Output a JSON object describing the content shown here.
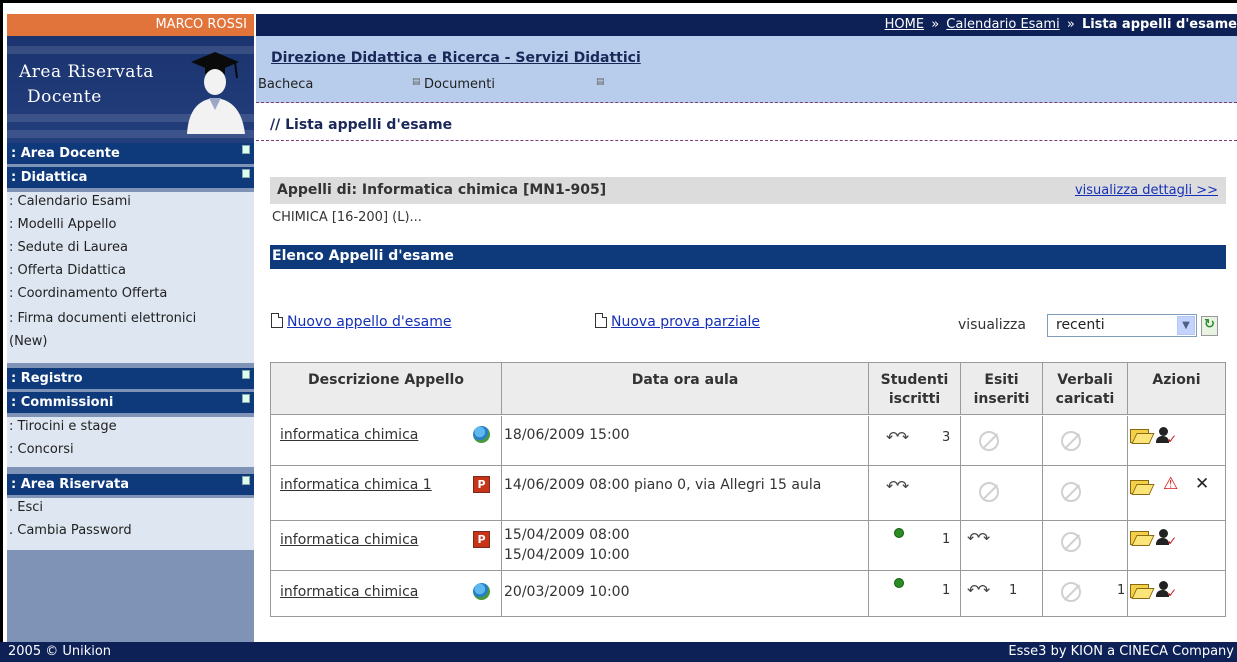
{
  "user": {
    "name": "MARCO ROSSI"
  },
  "breadcrumb": {
    "home": "HOME",
    "sep1": "»",
    "calendario": "Calendario Esami",
    "sep2": "»",
    "current": "Lista appelli d'esame"
  },
  "sidebar": {
    "logo_line1": "Area Riservata",
    "logo_line2": "Docente",
    "sections": {
      "area_docente": ": Area Docente",
      "didattica": ": Didattica",
      "registro": ": Registro",
      "commissioni": ": Commissioni",
      "area_riservata": ": Area Riservata"
    },
    "didattica_items": [
      ": Calendario Esami",
      ": Modelli Appello",
      ": Sedute di Laurea",
      ": Offerta Didattica",
      ": Coordinamento Offerta",
      ": Firma documenti elettronici (New)"
    ],
    "commissioni_items": [
      ": Tirocini e stage",
      ": Concorsi"
    ],
    "riservata_items": [
      ". Esci",
      ". Cambia Password"
    ]
  },
  "header": {
    "dept": "Direzione Didattica e Ricerca - Servizi Didattici",
    "tabs": [
      "Bacheca",
      "Documenti"
    ],
    "page_title": "// Lista appelli d'esame"
  },
  "appelli": {
    "label": "Appelli di: Informatica chimica [MN1-905]",
    "details_link": "visualizza dettagli >>",
    "course": "CHIMICA [16-200] (L)..."
  },
  "elenco": {
    "title": "Elenco Appelli d'esame"
  },
  "actions": {
    "nuovo_appello": "Nuovo appello d'esame",
    "nuova_prova": "Nuova prova parziale",
    "visualizza_label": "visualizza",
    "visualizza_value": "recenti"
  },
  "table": {
    "headers": {
      "descrizione": "Descrizione Appello",
      "data": "Data ora aula",
      "studenti": "Studenti iscritti",
      "esiti": "Esiti inseriti",
      "verbali": "Verbali caricati",
      "azioni": "Azioni"
    },
    "rows": [
      {
        "desc": "informatica chimica",
        "date": "18/06/2009 15:00",
        "iscritti": "3",
        "esiti": "",
        "verbali": ""
      },
      {
        "desc": "informatica chimica 1",
        "date": "14/06/2009 08:00 piano 0, via Allegri 15 aula",
        "iscritti": "",
        "esiti": "",
        "verbali": ""
      },
      {
        "desc": "informatica chimica",
        "date": "15/04/2009 08:00\n15/04/2009 10:00",
        "iscritti": "1",
        "esiti": "",
        "verbali": ""
      },
      {
        "desc": "informatica chimica",
        "date": "20/03/2009 10:00",
        "iscritti": "1",
        "esiti": "1",
        "verbali": "1"
      }
    ]
  },
  "footer": {
    "left": "2005 © Unikion",
    "right": "Esse3 by KION a CINECA Company"
  }
}
